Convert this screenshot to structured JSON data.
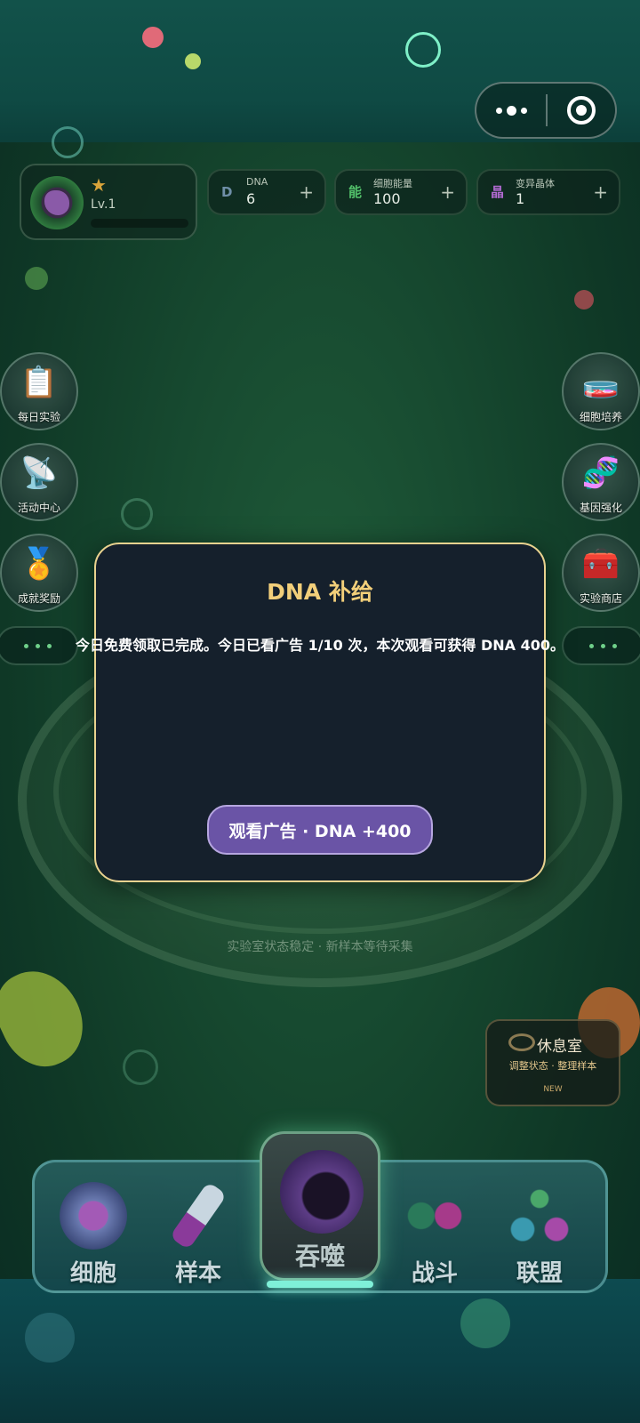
{
  "capsule": {
    "more_icon": "more-dots-icon",
    "close_icon": "target-close-icon"
  },
  "profile": {
    "level": "Lv.1",
    "star_icon": "star-icon"
  },
  "resources": [
    {
      "icon_text": "D",
      "label": "DNA",
      "value": "6",
      "plus": "+",
      "color": "#6f8fa8"
    },
    {
      "icon_text": "能",
      "label": "细胞能量",
      "value": "100",
      "plus": "+",
      "color": "#52c06a"
    },
    {
      "icon_text": "晶",
      "label": "变异晶体",
      "value": "1",
      "plus": "+",
      "color": "#b06ad0"
    }
  ],
  "left_buttons": [
    {
      "label": "每日实验",
      "icon": "clipboard-icon"
    },
    {
      "label": "活动中心",
      "icon": "signal-tower-icon"
    },
    {
      "label": "成就奖励",
      "icon": "medal-icon"
    }
  ],
  "right_buttons": [
    {
      "label": "细胞培养",
      "icon": "petri-dish-icon"
    },
    {
      "label": "基因强化",
      "icon": "dna-upgrade-icon"
    },
    {
      "label": "实验商店",
      "icon": "shop-box-icon"
    }
  ],
  "status_line": "实验室状态稳定 · 新样本等待采集",
  "lounge": {
    "title": "休息室",
    "subtitle": "调整状态 · 整理样本",
    "badge": "NEW"
  },
  "nav": {
    "items": [
      {
        "label": "细胞",
        "icon": "cell-icon"
      },
      {
        "label": "样本",
        "icon": "test-tube-icon"
      },
      {
        "label": "战斗",
        "icon": "battle-cells-icon"
      },
      {
        "label": "联盟",
        "icon": "alliance-icon"
      }
    ],
    "center": {
      "label": "吞噬",
      "icon": "devour-mouth-icon"
    }
  },
  "modal": {
    "title": "DNA 补给",
    "message": "今日免费领取已完成。今日已看广告 1/10 次，本次观看可获得 DNA 400。",
    "button": "观看广告 · DNA +400"
  },
  "colors": {
    "accent_gold": "#f2cf7a",
    "modal_border": "#e9d28f",
    "button_purple": "#6a54a6"
  }
}
